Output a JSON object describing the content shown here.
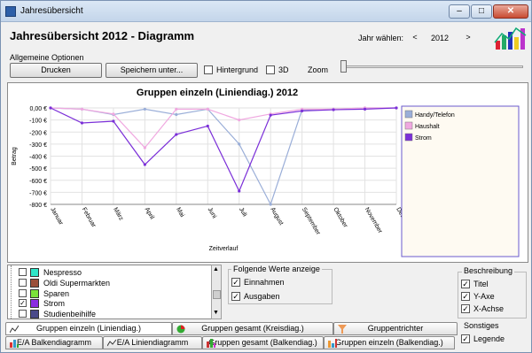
{
  "window": {
    "title": "Jahresübersicht",
    "min": "–",
    "max": "□",
    "close": "✕"
  },
  "header": {
    "title": "Jahresübersicht 2012 - Diagramm",
    "year_label": "Jahr wählen:",
    "prev": "<",
    "year": "2012",
    "next": ">"
  },
  "options": {
    "group_label": "Allgemeine Optionen",
    "print": "Drucken",
    "save": "Speichern unter...",
    "background": "Hintergrund",
    "three_d": "3D",
    "zoom": "Zoom"
  },
  "chart_data": {
    "type": "line",
    "title": "Gruppen einzeln (Liniendiag.) 2012",
    "xlabel": "Zeitverlauf",
    "ylabel": "Betrag",
    "categories": [
      "Januar",
      "Februar",
      "März",
      "April",
      "Mai",
      "Juni",
      "Juli",
      "August",
      "September",
      "Oktober",
      "November",
      "Dezember"
    ],
    "yticks": [
      "0,00 €",
      "-100 €",
      "-200 €",
      "-300 €",
      "-400 €",
      "-500 €",
      "-600 €",
      "-700 €",
      "-800 €"
    ],
    "ylim": [
      -800,
      0
    ],
    "grid": true,
    "legend_position": "right",
    "series": [
      {
        "name": "Handy/Telefon",
        "color": "#9aaed8",
        "values": [
          0,
          -10,
          -55,
          -10,
          -55,
          -10,
          -300,
          -800,
          -15,
          -10,
          0,
          0
        ]
      },
      {
        "name": "Haushalt",
        "color": "#f0a8e0",
        "values": [
          0,
          -10,
          -50,
          -330,
          -10,
          -10,
          -100,
          -50,
          -10,
          -10,
          0,
          0
        ]
      },
      {
        "name": "Strom",
        "color": "#7b2fd8",
        "values": [
          0,
          -125,
          -110,
          -470,
          -220,
          -150,
          -690,
          -60,
          -25,
          -15,
          -10,
          0
        ]
      }
    ]
  },
  "tree": {
    "items": [
      {
        "label": "Nespresso",
        "color": "#2ee6c8",
        "checked": ""
      },
      {
        "label": "Oldi Supermarkten",
        "color": "#9b4f3a",
        "checked": ""
      },
      {
        "label": "Sparen",
        "color": "#7be23a",
        "checked": ""
      },
      {
        "label": "Strom",
        "color": "#8a2be2",
        "checked": "✓"
      },
      {
        "label": "Studienbeihilfe",
        "color": "#4a4a8a",
        "checked": ""
      }
    ]
  },
  "values_group": {
    "label": "Folgende Werte anzeige",
    "income": "Einnahmen",
    "expenses": "Ausgaben",
    "income_checked": "✓",
    "expenses_checked": "✓"
  },
  "description": {
    "label": "Beschreibung",
    "title": "Titel",
    "yaxis": "Y-Axe",
    "xaxis": "X-Achse",
    "other": "Sonstiges",
    "legend": "Legende"
  },
  "tabs_top": [
    "Gruppen einzeln (Liniendiag.)",
    "Gruppen gesamt (Kreisdiag.)",
    "Gruppentrichter"
  ],
  "tabs_bottom": [
    "E/A Balkendiagramm",
    "E/A Liniendiagramm",
    "Gruppen gesamt (Balkendiag.)",
    "Gruppen einzeln (Balkendiag.)"
  ]
}
